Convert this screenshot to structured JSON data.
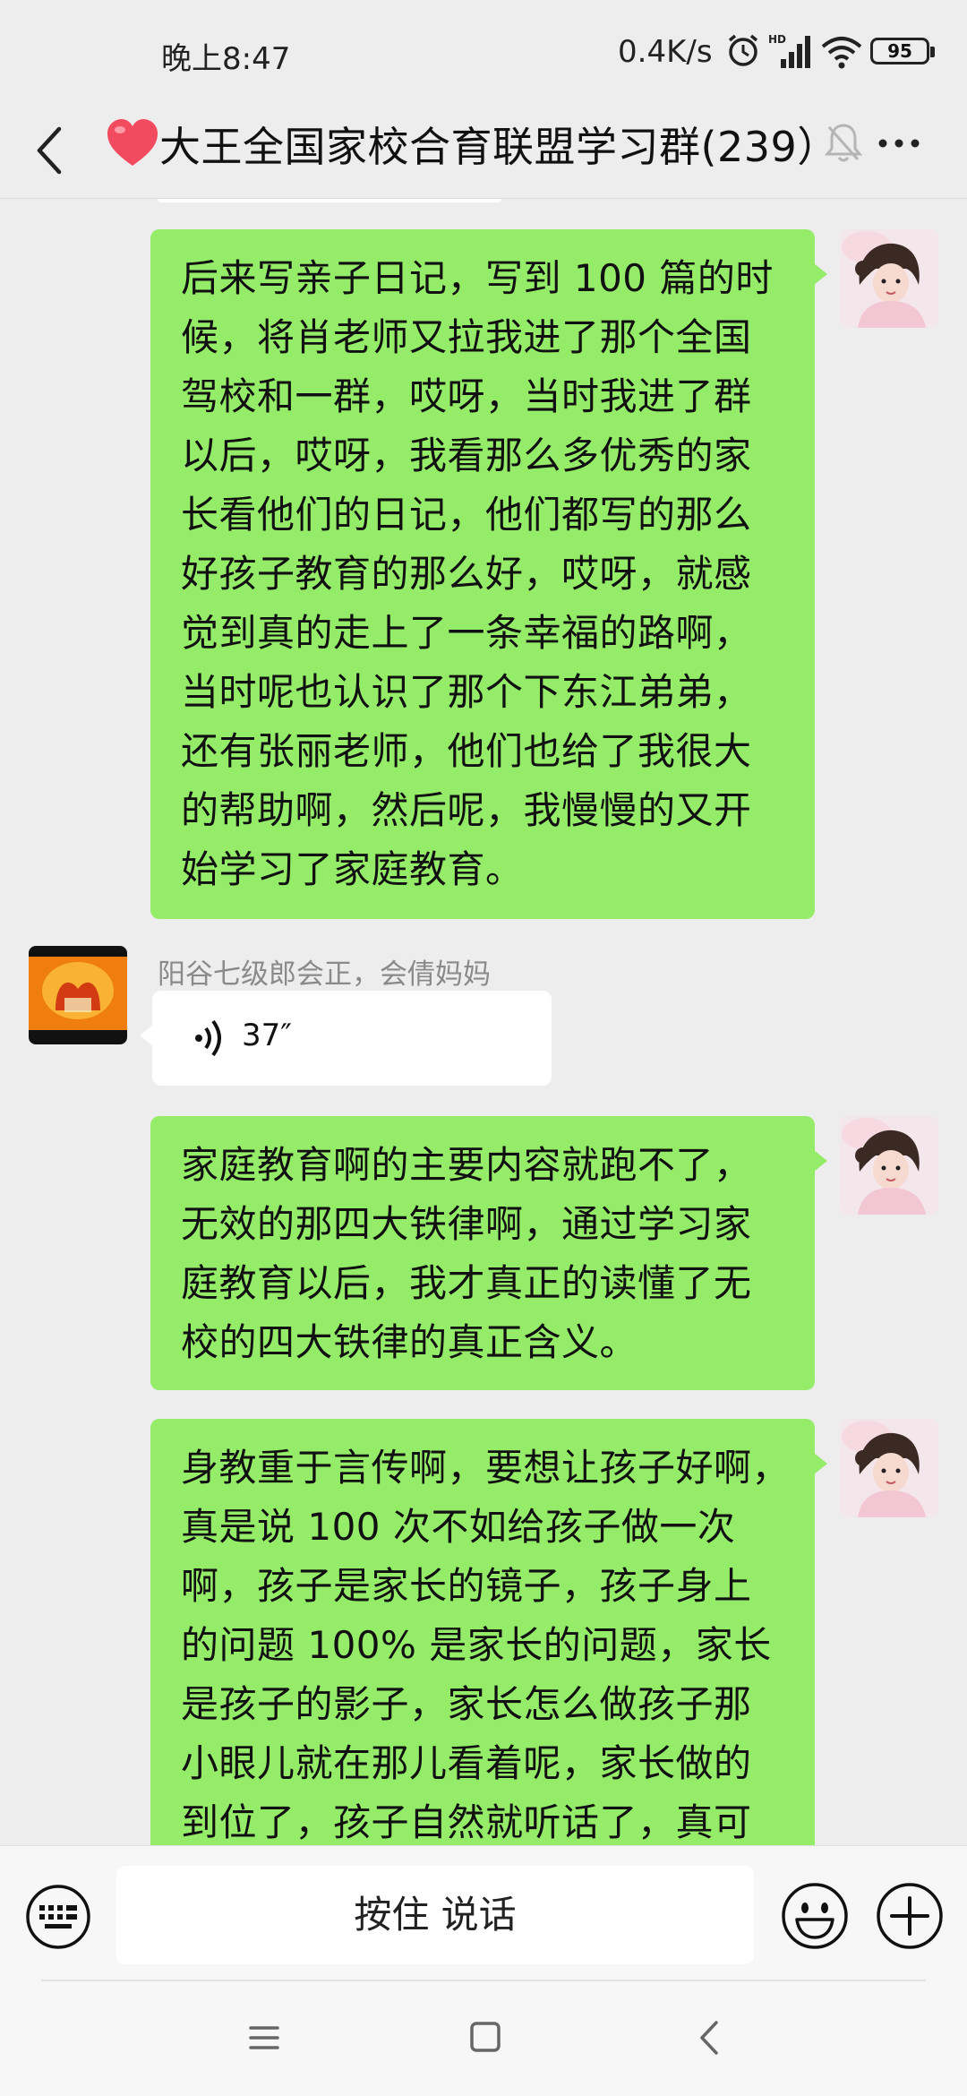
{
  "status_bar": {
    "time": "晚上8:47",
    "net_speed": "0.4K/s",
    "battery": "95",
    "icons": [
      "alarm-icon",
      "hd-signal-icon",
      "wifi-icon",
      "battery-icon"
    ]
  },
  "header": {
    "title": "大王全国家校合育联盟学习群(239）",
    "icons": [
      "back-icon",
      "heart-emoji",
      "mute-icon",
      "more-icon"
    ]
  },
  "messages": [
    {
      "type": "text",
      "side": "right",
      "lines": [
        "后来写亲子日记，写到 100 篇的时",
        "候，将肖老师又拉我进了那个全国",
        "驾校和一群，哎呀，当时我进了群",
        "以后，哎呀，我看那么多优秀的家",
        "长看他们的日记，他们都写的那么",
        "好孩子教育的那么好，哎呀，就感",
        "觉到真的走上了一条幸福的路啊，",
        "当时呢也认识了那个下东江弟弟，",
        "还有张丽老师，他们也给了我很大",
        "的帮助啊，然后呢，我慢慢的又开",
        "始学习了家庭教育。"
      ]
    },
    {
      "type": "voice",
      "side": "left",
      "sender": "阳谷七级郎会正，会倩妈妈",
      "duration": "37″"
    },
    {
      "type": "text",
      "side": "right",
      "lines": [
        "家庭教育啊的主要内容就跑不了，",
        "无效的那四大铁律啊，通过学习家",
        "庭教育以后，我才真正的读懂了无",
        "校的四大铁律的真正含义。"
      ]
    },
    {
      "type": "text",
      "side": "right",
      "lines": [
        "身教重于言传啊，要想让孩子好啊，",
        "真是说 100 次不如给孩子做一次",
        "啊，孩子是家长的镜子，孩子身上",
        "的问题 100% 是家长的问题，家长",
        "是孩子的影子，家长怎么做孩子那",
        "小眼儿就在那儿看着呢，家长做的",
        "到位了，孩子自然就听话了，真可"
      ]
    }
  ],
  "input_bar": {
    "hold_to_talk": "按住 说话",
    "icons": [
      "keyboard-icon",
      "emoji-icon",
      "plus-icon"
    ]
  },
  "colors": {
    "bubble_green": "#95ec69",
    "background": "#ededed"
  }
}
